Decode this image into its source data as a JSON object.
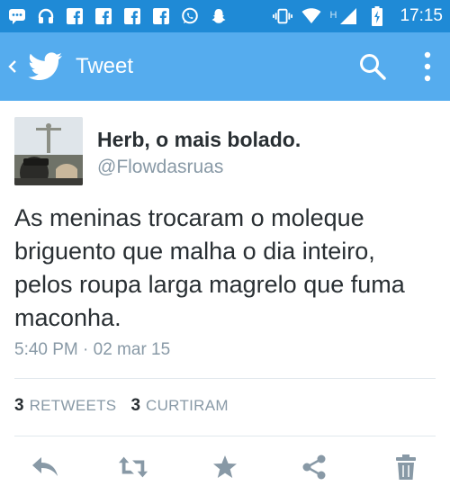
{
  "statusbar": {
    "time": "17:15",
    "network_label": "H",
    "icons": [
      "chat-icon",
      "headphones-icon",
      "facebook-icon",
      "facebook-icon",
      "facebook-icon",
      "facebook-icon",
      "whatsapp-icon",
      "snapchat-icon",
      "vibrate-icon",
      "wifi-icon",
      "signal-icon",
      "battery-charging-icon"
    ]
  },
  "toolbar": {
    "title": "Tweet",
    "back_icon": "chevron-left-icon",
    "logo_icon": "twitter-bird-icon",
    "search_icon": "search-icon",
    "more_icon": "overflow-menu-icon"
  },
  "tweet": {
    "author_name": "Herb, o mais bolado.",
    "author_handle": "@Flowdasruas",
    "text": "As meninas trocaram o moleque briguento que malha o dia inteiro, pelos roupa larga magrelo que fuma maconha.",
    "timestamp": "5:40 PM · 02 mar 15",
    "retweets_count": "3",
    "retweets_label": "RETWEETS",
    "likes_count": "3",
    "likes_label": "CURTIRAM"
  },
  "actions": [
    "reply-icon",
    "retweet-icon",
    "favorite-star-icon",
    "share-icon",
    "delete-trash-icon"
  ],
  "colors": {
    "statusbar": "#1f8ad6",
    "toolbar": "#55acee",
    "text": "#292f33",
    "muted": "#8899a6",
    "action_icon": "#8899a6"
  }
}
